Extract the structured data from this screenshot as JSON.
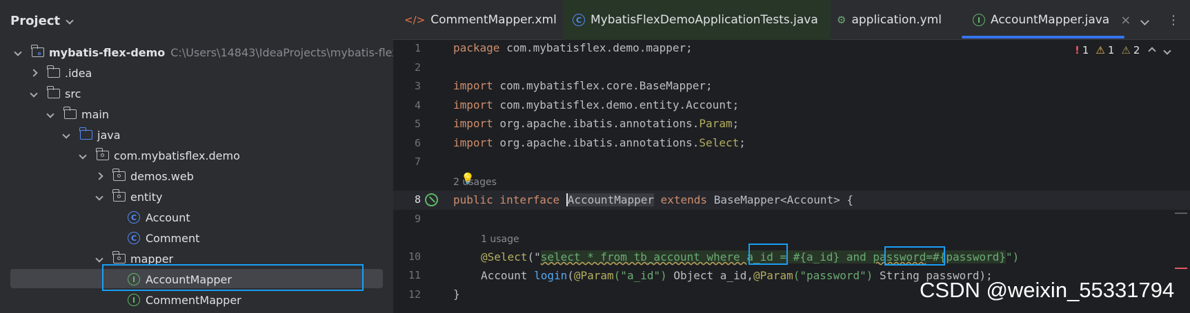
{
  "sidebar": {
    "title": "Project",
    "tree": [
      {
        "label": "mybatis-flex-demo",
        "path": "C:\\Users\\14843\\IdeaProjects\\mybatis-flex-d"
      },
      {
        "label": ".idea"
      },
      {
        "label": "src"
      },
      {
        "label": "main"
      },
      {
        "label": "java"
      },
      {
        "label": "com.mybatisflex.demo"
      },
      {
        "label": "demos.web"
      },
      {
        "label": "entity"
      },
      {
        "label": "Account"
      },
      {
        "label": "Comment"
      },
      {
        "label": "mapper"
      },
      {
        "label": "AccountMapper"
      },
      {
        "label": "CommentMapper"
      }
    ]
  },
  "tabs": [
    {
      "label": "CommentMapper.xml",
      "icon": "xml-icon"
    },
    {
      "label": "MybatisFlexDemoApplicationTests.java",
      "icon": "class-icon"
    },
    {
      "label": "application.yml",
      "icon": "yml-icon"
    },
    {
      "label": "AccountMapper.java",
      "icon": "interface-icon",
      "active": true
    }
  ],
  "inspections": {
    "errors": "1",
    "warnings": "1",
    "weak_warnings": "2"
  },
  "editor": {
    "line_numbers": [
      "1",
      "2",
      "3",
      "4",
      "5",
      "6",
      "7",
      "8",
      "9",
      "10",
      "11",
      "12"
    ],
    "line1_kw": "package",
    "line1_rest": " com.mybatisflex.demo.mapper;",
    "line3_kw": "import",
    "line3_rest": " com.mybatisflex.core.BaseMapper;",
    "line4_kw": "import",
    "line4_rest": " com.mybatisflex.demo.entity.Account;",
    "line5_kw": "import",
    "line5_rest": " org.apache.ibatis.annotations.",
    "line5_ann": "Param",
    "line5_end": ";",
    "line6_kw": "import",
    "line6_rest": " org.apache.ibatis.annotations.",
    "line6_ann": "Select",
    "line6_end": ";",
    "usages_hint": "2 usages",
    "line8_kw1": "public interface ",
    "line8_name": "AccountMapper",
    "line8_kw2": " extends ",
    "line8_rest": "BaseMapper<Account> {",
    "usage_hint": "1 usage",
    "line10_ann": "@Select",
    "line10_p1": "(\"",
    "line10_sql1": "select * from tb_account where ",
    "line10_sql_aid": "a_id",
    "line10_sql2": " = #{a_id} and ",
    "line10_sql_pw": "password",
    "line10_sql3": "=#{password}",
    "line10_end": "\")",
    "line11_type": "Account ",
    "line11_fn": "login",
    "line11_p1": "(",
    "line11_ann1": "@Param",
    "line11_s1": "(\"a_id\")",
    "line11_mid": " Object a_id,",
    "line11_ann2": "@Param",
    "line11_s2": "(\"password\")",
    "line11_end": " String password);",
    "line12": "}"
  },
  "watermark": "CSDN @weixin_55331794"
}
